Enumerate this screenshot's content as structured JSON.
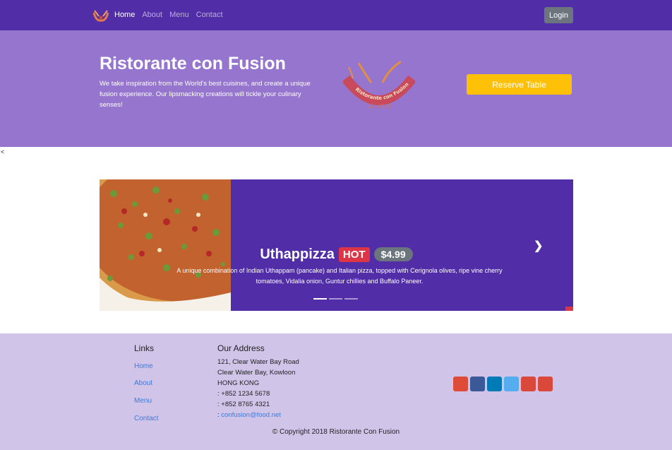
{
  "nav": {
    "links": [
      {
        "label": "Home"
      },
      {
        "label": "About"
      },
      {
        "label": "Menu"
      },
      {
        "label": "Contact"
      }
    ],
    "login_label": "Login"
  },
  "jumbotron": {
    "title": "Ristorante con Fusion",
    "description": "We take inspiration from the World's best cuisines, and create a unique fusion experience. Our lipsmacking creations will tickle your culinary senses!",
    "logo_text": "Ristorante con Fusion",
    "logo_est": "Est. 1813",
    "reserve_label": "Reserve Table"
  },
  "stray_char": "<",
  "carousel": {
    "dish_name": "Uthappizza",
    "badge": "HOT",
    "price": "$4.99",
    "description": "A unique combination of Indian Uthappam (pancake) and Italian pizza, topped with Cerignola olives, ripe vine cherry tomatoes, Vidalia onion, Guntur chillies and Buffalo Paneer.",
    "next_icon": "chevron-right-icon",
    "active_index": 0
  },
  "footer": {
    "links_heading": "Links",
    "links": [
      "Home",
      "About",
      "Menu",
      "Contact"
    ],
    "address_heading": "Our Address",
    "address_lines": [
      "121, Clear Water Bay Road",
      "Clear Water Bay, Kowloon",
      "HONG KONG",
      ": +852 1234 5678",
      ": +852 8765 4321"
    ],
    "email_prefix": ": ",
    "email": "confusion@food.net",
    "socials": [
      {
        "icon": "google-plus-icon",
        "color": "#dd4b39"
      },
      {
        "icon": "facebook-icon",
        "color": "#3b5998"
      },
      {
        "icon": "linkedin-icon",
        "color": "#007bb6"
      },
      {
        "icon": "twitter-icon",
        "color": "#55acee"
      },
      {
        "icon": "youtube-icon",
        "color": "#d9483b"
      },
      {
        "icon": "mail-icon",
        "color": "#d9483b"
      }
    ],
    "copyright": "© Copyright 2018 Ristorante Con Fusion"
  },
  "colors": {
    "primary": "#512DA8",
    "jumbotron": "#9575CD",
    "footer": "#D1C4E9",
    "warning": "#FFC107",
    "danger": "#dc3545",
    "secondary": "#6c757d"
  }
}
